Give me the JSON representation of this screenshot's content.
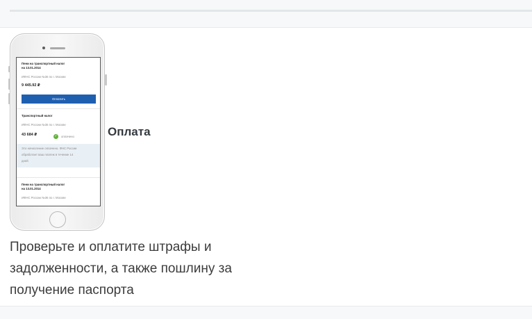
{
  "phone": {
    "card1": {
      "title_line1": "Пени на транспортный налог",
      "title_line2": "на 13.01.2014",
      "org": "ИФНС России №36 по г. Москве",
      "amount": "9 445.92 ₽",
      "button": "Оплатить"
    },
    "card2": {
      "title": "Транспортный налог",
      "org": "ИФНС России №36 по г. Москве",
      "amount": "43 684 ₽",
      "status": "оплачено",
      "note_line1": "Это начисление оплачено. ФНС России",
      "note_line2": "обработает ваш платеж в течение 14",
      "note_line3": "дней"
    },
    "card3": {
      "title_line1": "Пени на транспортный налог",
      "title_line2": "на 13.01.2014",
      "org": "ИФНС России №36 по г. Москве"
    }
  },
  "feature": {
    "title": "Оплата",
    "desc": "Проверьте и оплатите штрафы и задолженности, а также пошлину за получение паспорта"
  }
}
